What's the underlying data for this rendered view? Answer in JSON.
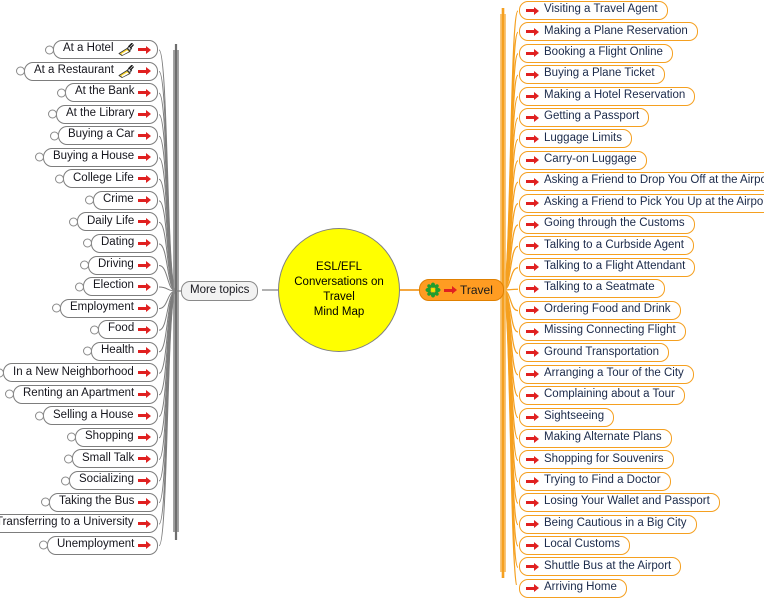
{
  "map": {
    "title": "ESL/EFL Conversations on Travel Mind Map",
    "central": {
      "lines": [
        "ESL/EFL",
        "Conversations on",
        "Travel",
        "Mind Map"
      ],
      "fill": "#ffff00",
      "stroke": "#808080"
    },
    "colors": {
      "right_branch": "#f5a020",
      "left_branch": "#7d7d7d",
      "arrow_red": "#e02020",
      "travel_fill": "#ff9c22",
      "central_fill": "#ffff00"
    }
  },
  "branches": {
    "right": {
      "label": "Travel",
      "icon": "flower-icon",
      "arrow": "red-arrow-icon",
      "items": [
        {
          "label": "Visiting a Travel Agent",
          "icon": "red-arrow-icon"
        },
        {
          "label": "Making a Plane Reservation",
          "icon": "red-arrow-icon"
        },
        {
          "label": "Booking a Flight Online",
          "icon": "red-arrow-icon"
        },
        {
          "label": "Buying a Plane Ticket",
          "icon": "red-arrow-icon"
        },
        {
          "label": "Making a Hotel Reservation",
          "icon": "red-arrow-icon"
        },
        {
          "label": "Getting a Passport",
          "icon": "red-arrow-icon"
        },
        {
          "label": "Luggage Limits",
          "icon": "red-arrow-icon"
        },
        {
          "label": "Carry-on Luggage",
          "icon": "red-arrow-icon"
        },
        {
          "label": "Asking a Friend to Drop You Off at the Airport",
          "icon": "red-arrow-icon"
        },
        {
          "label": "Asking a Friend to Pick You Up at the Airport",
          "icon": "red-arrow-icon"
        },
        {
          "label": "Going through the Customs",
          "icon": "red-arrow-icon"
        },
        {
          "label": "Talking to a Curbside Agent",
          "icon": "red-arrow-icon"
        },
        {
          "label": "Talking to a Flight Attendant",
          "icon": "red-arrow-icon"
        },
        {
          "label": "Talking to a Seatmate",
          "icon": "red-arrow-icon"
        },
        {
          "label": "Ordering Food and Drink",
          "icon": "red-arrow-icon"
        },
        {
          "label": "Missing Connecting Flight",
          "icon": "red-arrow-icon"
        },
        {
          "label": "Ground Transportation",
          "icon": "red-arrow-icon"
        },
        {
          "label": "Arranging a Tour of the City",
          "icon": "red-arrow-icon"
        },
        {
          "label": "Complaining about a Tour",
          "icon": "red-arrow-icon"
        },
        {
          "label": "Sightseeing",
          "icon": "red-arrow-icon"
        },
        {
          "label": "Making Alternate Plans",
          "icon": "red-arrow-icon"
        },
        {
          "label": "Shopping for Souvenirs",
          "icon": "red-arrow-icon"
        },
        {
          "label": "Trying to Find a Doctor",
          "icon": "red-arrow-icon"
        },
        {
          "label": "Losing Your Wallet and Passport",
          "icon": "red-arrow-icon"
        },
        {
          "label": "Being Cautious in a Big City",
          "icon": "red-arrow-icon"
        },
        {
          "label": "Local Customs",
          "icon": "red-arrow-icon"
        },
        {
          "label": "Shuttle Bus at the Airport",
          "icon": "red-arrow-icon"
        },
        {
          "label": "Arriving Home",
          "icon": "red-arrow-icon"
        }
      ]
    },
    "left": {
      "label": "More topics",
      "items": [
        {
          "label": "At a Hotel",
          "icon": "red-arrow-icon",
          "note_icon": "note-pen-icon"
        },
        {
          "label": "At a Restaurant",
          "icon": "red-arrow-icon",
          "note_icon": "note-pen-icon"
        },
        {
          "label": "At the Bank",
          "icon": "red-arrow-icon"
        },
        {
          "label": "At the Library",
          "icon": "red-arrow-icon"
        },
        {
          "label": "Buying a Car",
          "icon": "red-arrow-icon"
        },
        {
          "label": "Buying a House",
          "icon": "red-arrow-icon"
        },
        {
          "label": "College Life",
          "icon": "red-arrow-icon"
        },
        {
          "label": "Crime",
          "icon": "red-arrow-icon"
        },
        {
          "label": "Daily Life",
          "icon": "red-arrow-icon"
        },
        {
          "label": "Dating",
          "icon": "red-arrow-icon"
        },
        {
          "label": "Driving",
          "icon": "red-arrow-icon"
        },
        {
          "label": "Election",
          "icon": "red-arrow-icon"
        },
        {
          "label": "Employment",
          "icon": "red-arrow-icon"
        },
        {
          "label": "Food",
          "icon": "red-arrow-icon"
        },
        {
          "label": "Health",
          "icon": "red-arrow-icon"
        },
        {
          "label": "In a New Neighborhood",
          "icon": "red-arrow-icon"
        },
        {
          "label": "Renting an Apartment",
          "icon": "red-arrow-icon"
        },
        {
          "label": "Selling a House",
          "icon": "red-arrow-icon"
        },
        {
          "label": "Shopping",
          "icon": "red-arrow-icon"
        },
        {
          "label": "Small Talk",
          "icon": "red-arrow-icon"
        },
        {
          "label": "Socializing",
          "icon": "red-arrow-icon"
        },
        {
          "label": "Taking the Bus",
          "icon": "red-arrow-icon"
        },
        {
          "label": "Transferring to a University",
          "icon": "red-arrow-icon"
        },
        {
          "label": "Unemployment",
          "icon": "red-arrow-icon"
        }
      ]
    }
  }
}
